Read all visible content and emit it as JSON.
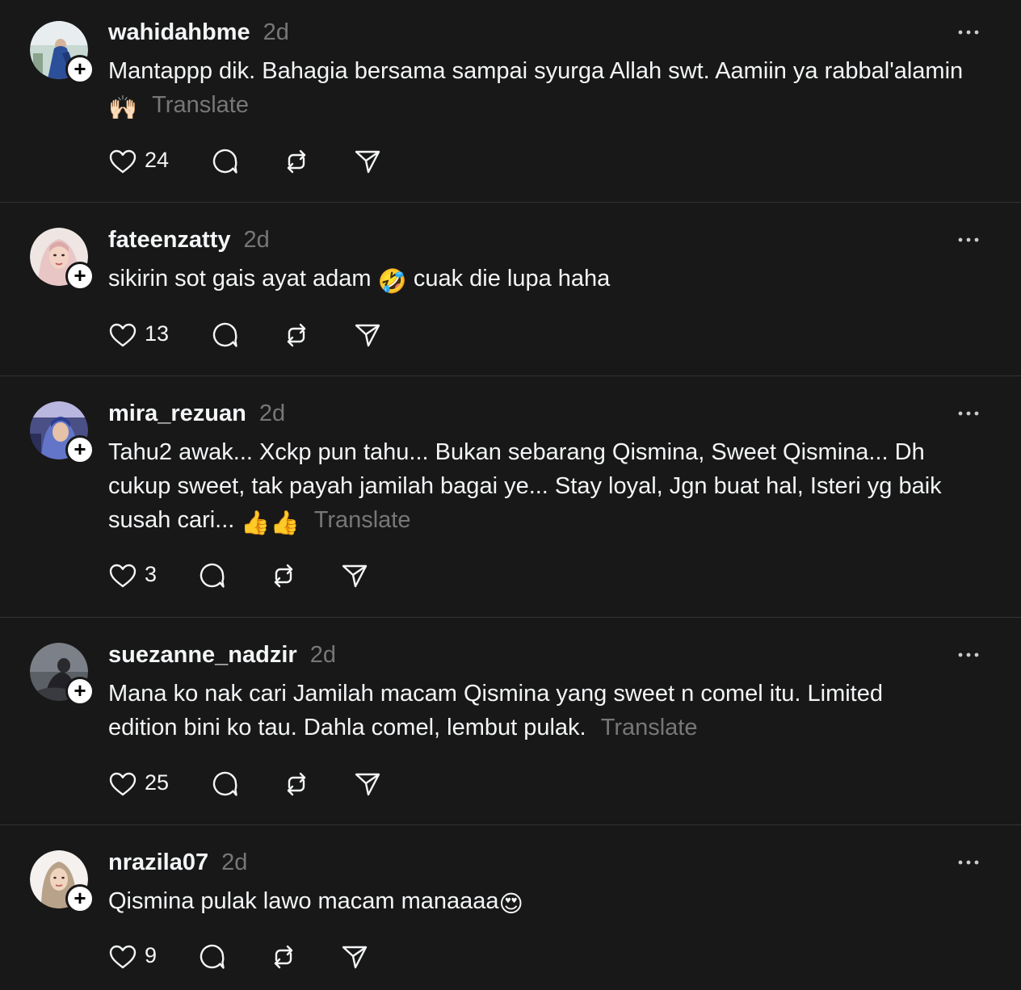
{
  "posts": [
    {
      "username": "wahidahbme",
      "time": "2d",
      "text": "Mantappp dik. Bahagia bersama sampai syurga Allah swt. Aamiin ya rabbal'alamin",
      "emoji": "🙌🏻",
      "translate": "Translate",
      "likes": "24"
    },
    {
      "username": "fateenzatty",
      "time": "2d",
      "text": "sikirin sot gais ayat adam",
      "emoji": "🤣",
      "text_after": "cuak die lupa haha",
      "likes": "13"
    },
    {
      "username": "mira_rezuan",
      "time": "2d",
      "text": "Tahu2 awak... Xckp pun tahu... Bukan sebarang Qismina, Sweet Qismina... Dh cukup sweet, tak payah jamilah bagai ye... Stay loyal, Jgn buat hal, Isteri yg baik susah cari...",
      "emoji": "👍👍",
      "translate": "Translate",
      "likes": "3"
    },
    {
      "username": "suezanne_nadzir",
      "time": "2d",
      "text": "Mana ko nak cari Jamilah macam Qismina yang sweet n comel itu. Limited edition bini ko tau. Dahla comel, lembut pulak.",
      "translate": "Translate",
      "likes": "25"
    },
    {
      "username": "nrazila07",
      "time": "2d",
      "text": "Qismina pulak lawo macam manaaaa",
      "emoji": "😍",
      "likes": "9"
    }
  ],
  "icons": {
    "like": "heart-icon",
    "reply": "comment-icon",
    "repost": "repost-icon",
    "share": "send-icon",
    "more": "more-icon",
    "follow": "plus-icon"
  },
  "colors": {
    "background": "#181818",
    "text": "#f3f5f7",
    "secondary": "#777777",
    "divider": "#333333"
  }
}
